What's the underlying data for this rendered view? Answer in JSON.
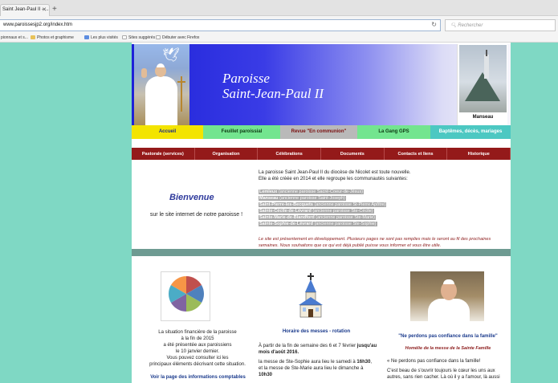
{
  "browser": {
    "tab_title": "Saint Jean-Paul II - ...",
    "new_tab": "+",
    "url": "www.paroissesjp2.org/index.htm",
    "search_placeholder": "Rechercher",
    "bookmarks": [
      "pionnaux et s...",
      "Photos et graphisme",
      "Les plus visités",
      "Sites suggérés",
      "Débuter avec Firefox"
    ]
  },
  "header": {
    "title_line1": "Paroisse",
    "title_line2": "Saint-Jean-Paul II",
    "church_caption": "Manseau"
  },
  "menu_top": [
    {
      "label": "Accueil",
      "bg": "#f3e400",
      "color": "#1a2a8a"
    },
    {
      "label": "Feuillet paroissial",
      "bg": "#73e58f",
      "color": "#0f3a14"
    },
    {
      "label": "Revue \"En communion\"",
      "bg": "#b9b9b9",
      "color": "#7a1010"
    },
    {
      "label": "La Gang GPS",
      "bg": "#73e58f",
      "color": "#0f3a14"
    },
    {
      "label": "Baptêmes, décès, mariages",
      "bg": "#4cc8c2",
      "color": "#ffffff"
    }
  ],
  "menu_main": [
    "Pastorale (services)",
    "Organisation",
    "Célébrations",
    "Documents",
    "Contacts et liens",
    "Historique"
  ],
  "welcome": {
    "title": "Bienvenue",
    "subtitle": "sur le site internet de notre paroisse !"
  },
  "intro": {
    "line1": "La paroisse Saint Jean-Paul II du diocèse de Nicolet est toute nouvelle.",
    "line2": "Elle a été créée en 2014 et elle regroupe les communautés suivantes:",
    "communities": [
      {
        "name": "Lemieux",
        "former": "(ancienne paroisse Sacré-Coeur-de-Jésus)"
      },
      {
        "name": "Manseau",
        "former": "(ancienne paroisse Saint-Joseph)"
      },
      {
        "name": "Saint-Pierre-les-Becquets",
        "former": "(ancienne paroisse St-Pierre Apôtre)"
      },
      {
        "name": "Sainte-Cécile-de-Lévrard",
        "former": "(ancienne paroisse Ste-Cécile)"
      },
      {
        "name": "Sainte-Marie-de-Blandford",
        "former": "(ancienne paroisse Ste-Marie)"
      },
      {
        "name": "Sainte-Sophie-de-Lévrard",
        "former": "(ancienne paroisse Ste-Sophie)"
      }
    ],
    "note": "Le site est présentement en développement. Plusieurs pages ne sont pas remplies mais le seront au fil des prochaines semaines. Nous souhaitons que ce qui est déjà publié puisse vous informer et vous être utile."
  },
  "finance": {
    "text": [
      "La situation financière de la paroisse",
      "à la fin de 2015",
      "a été présentée aux paroissiens",
      "le 10 janvier dernier.",
      "Vous pouvez consulter ici les",
      "principaux éléments décrivant cette situation."
    ],
    "link": "Voir la page des informations comptables",
    "pie_colors": [
      "#c0504d",
      "#4f81bd",
      "#9bbb59",
      "#8064a2",
      "#4bacc6",
      "#f79646"
    ]
  },
  "masses": {
    "title": "Horaire des messes - rotation",
    "p1_prefix": "À partir de la fin de semaine des 6 et 7 février ",
    "p1_bold": "jusqu'au mois d'août 2016.",
    "p2_a": "la messe de Ste-Sophie  aura lieu le samedi à ",
    "p2_time1": "16h30",
    "p2_b": ",",
    "p3_a": "et la messe de Ste-Marie aura lieu le dimanche à ",
    "p3_time2": "10h30"
  },
  "quote": {
    "title": "\"Ne perdons pas confiance dans la famille\"",
    "subtitle": "Homélie de la messe de la Sainte Famille",
    "p1": "« Ne perdons pas confiance dans la famille!",
    "p2": "C'est beau de s'ouvrir toujours le cœur les uns aux autres, sans rien cacher. Là où il y a l'amour, là aussi"
  }
}
